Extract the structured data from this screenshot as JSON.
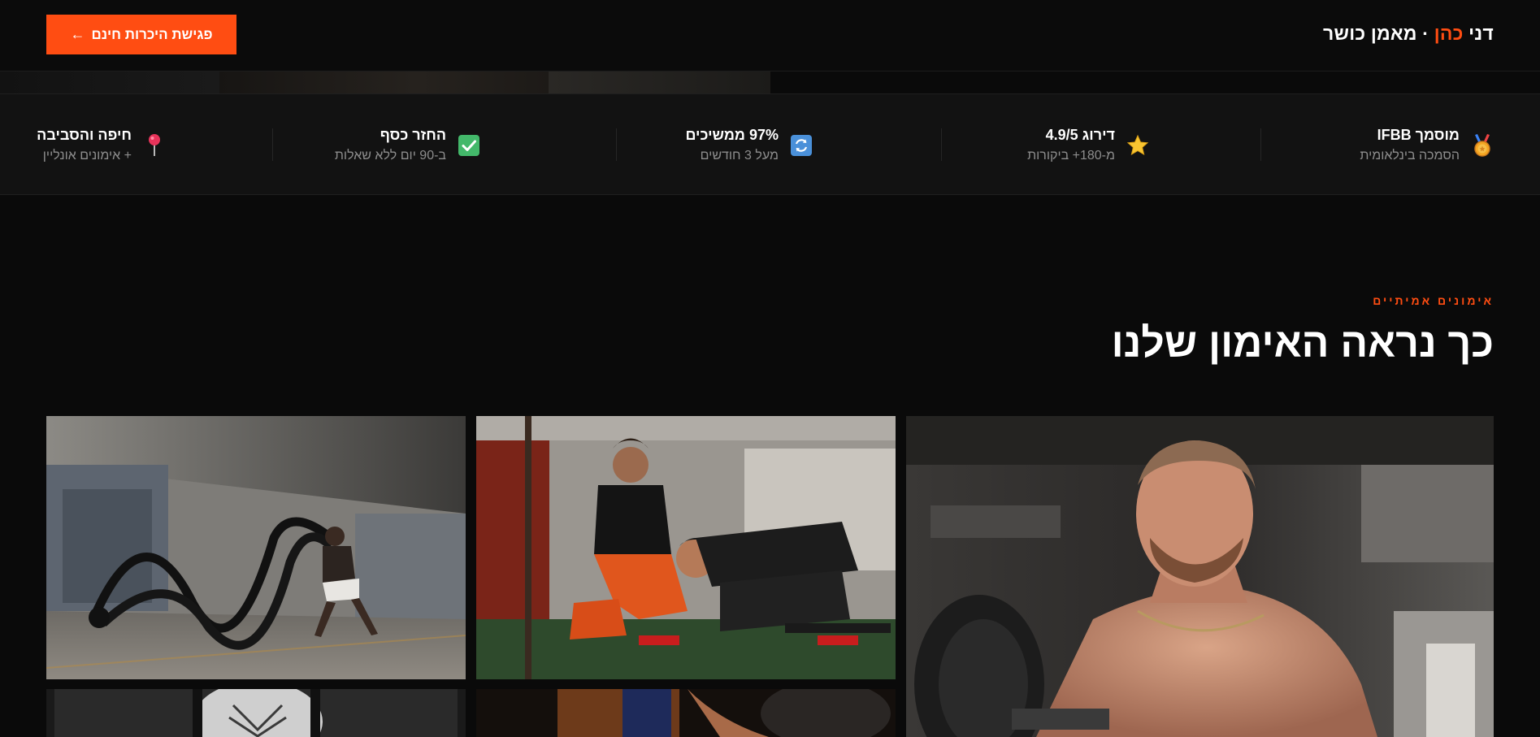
{
  "header": {
    "brand_first": "דני",
    "brand_accent": "כהן",
    "brand_rest": "· מאמן כושר",
    "cta_label": "פגישת היכרות חינם",
    "cta_arrow": "←"
  },
  "trust": [
    {
      "icon": "medal-icon",
      "title": "מוסמך IFBB",
      "sub": "הסמכה בינלאומית"
    },
    {
      "icon": "star-icon",
      "title": "דירוג 4.9/5",
      "sub": "מ-180+ ביקורות"
    },
    {
      "icon": "refresh-icon",
      "title": "97% ממשיכים",
      "sub": "מעל 3 חודשים"
    },
    {
      "icon": "check-icon",
      "title": "החזר כסף",
      "sub": "ב-90 יום ללא שאלות"
    },
    {
      "icon": "pin-icon",
      "title": "חיפה והסביבה",
      "sub": "+ אימונים אונליין"
    }
  ],
  "section": {
    "eyebrow": "אימונים אמיתיים",
    "title": "כך נראה האימון שלנו"
  },
  "gallery": [
    {
      "name": "gallery-photo-trainer-portrait"
    },
    {
      "name": "gallery-photo-pushup-coaching"
    },
    {
      "name": "gallery-photo-battle-ropes"
    },
    {
      "name": "gallery-photo-bottom-middle"
    },
    {
      "name": "gallery-photo-bottom-left"
    }
  ],
  "colors": {
    "accent": "#ff4d12",
    "background": "#0a0a0a",
    "bar": "#121212"
  }
}
